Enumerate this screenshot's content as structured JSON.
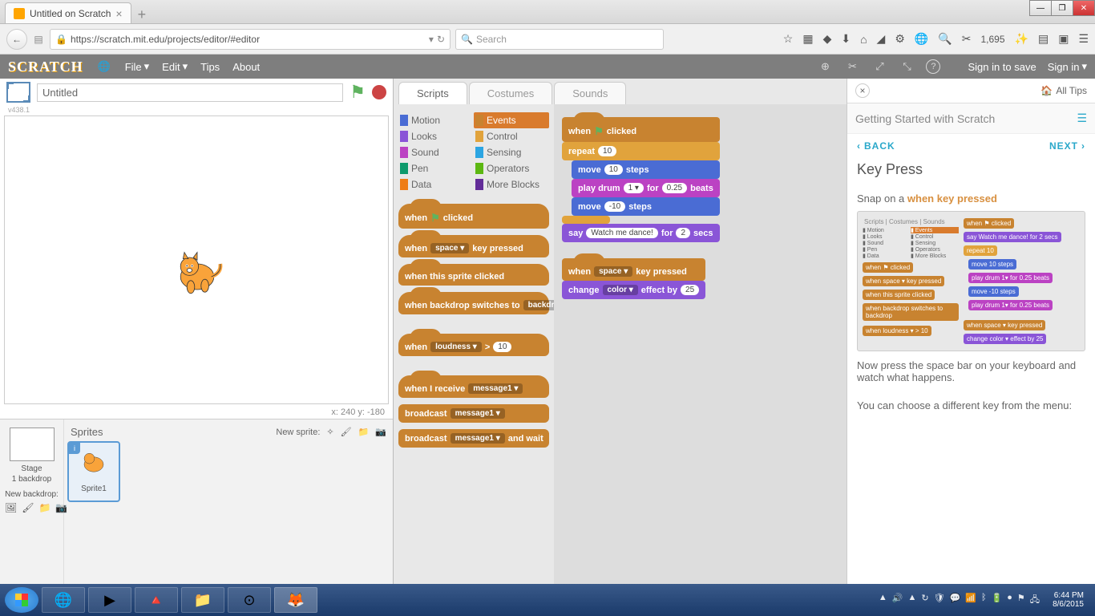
{
  "browser": {
    "tab_title": "Untitled on Scratch",
    "url": "https://scratch.mit.edu/projects/editor/#editor",
    "search_placeholder": "Search",
    "bookmark_count": "1,695"
  },
  "scratch_menu": {
    "file": "File",
    "edit": "Edit",
    "tips": "Tips",
    "about": "About",
    "signin_save": "Sign in to save",
    "signin": "Sign in"
  },
  "project": {
    "title": "Untitled",
    "version": "v438.1",
    "coords": "x: 240  y: -180"
  },
  "sprites": {
    "title": "Sprites",
    "new_sprite": "New sprite:",
    "stage": "Stage",
    "backdrop_count": "1 backdrop",
    "new_backdrop": "New backdrop:",
    "sprite1": "Sprite1"
  },
  "tabs": {
    "scripts": "Scripts",
    "costumes": "Costumes",
    "sounds": "Sounds"
  },
  "categories": {
    "motion": "Motion",
    "looks": "Looks",
    "sound": "Sound",
    "pen": "Pen",
    "data": "Data",
    "events": "Events",
    "control": "Control",
    "sensing": "Sensing",
    "operators": "Operators",
    "more": "More Blocks"
  },
  "palette_blocks": {
    "when_flag": "when",
    "clicked": "clicked",
    "when_key": "when",
    "key_space": "space",
    "key_pressed": "key pressed",
    "when_sprite": "when this sprite clicked",
    "when_backdrop": "when backdrop switches to",
    "backdrop_dd": "backdrop",
    "when_loudness": "when",
    "loudness_dd": "loudness",
    "gt": ">",
    "val10": "10",
    "when_receive": "when I receive",
    "msg1": "message1",
    "broadcast": "broadcast",
    "broadcast_wait_a": "broadcast",
    "broadcast_wait_b": "and wait"
  },
  "script1": {
    "when_flag": "when",
    "clicked": "clicked",
    "repeat": "repeat",
    "repeat_n": "10",
    "move": "move",
    "move_n": "10",
    "steps": "steps",
    "play_drum": "play drum",
    "drum_n": "1",
    "for": "for",
    "beats_n": "0.25",
    "beats": "beats",
    "move2": "move",
    "move2_n": "-10",
    "steps2": "steps",
    "say": "say",
    "say_txt": "Watch me dance!",
    "say_for": "for",
    "say_n": "2",
    "secs": "secs"
  },
  "script2": {
    "when_key": "when",
    "space": "space",
    "key_pressed": "key pressed",
    "change": "change",
    "color": "color",
    "effect_by": "effect by",
    "val": "25"
  },
  "tips": {
    "all_tips": "All Tips",
    "header": "Getting Started with Scratch",
    "back": "BACK",
    "next": "NEXT",
    "title": "Key Press",
    "line1a": "Snap on a ",
    "line1b": "when key pressed",
    "line2": "Now press the space bar on your keyboard and watch what happens.",
    "line3": "You can choose a different key from the menu:"
  },
  "taskbar": {
    "time": "6:44 PM",
    "date": "8/6/2015"
  }
}
